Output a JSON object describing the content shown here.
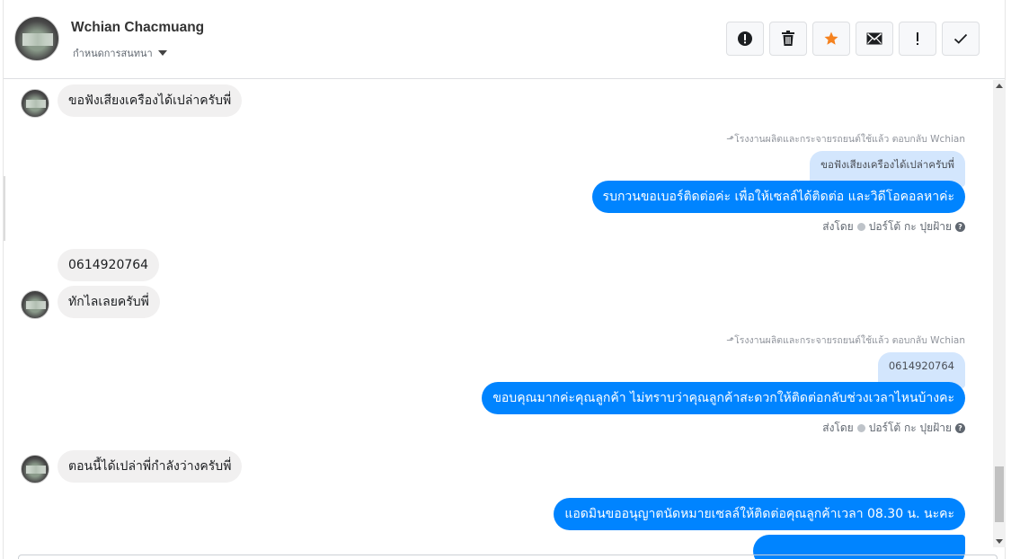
{
  "header": {
    "contact_name": "Wchian Chacmuang",
    "conversation_settings": "กำหนดการสนทนา",
    "actions": [
      {
        "name": "mark-spam",
        "icon": "exclamation-circle-icon"
      },
      {
        "name": "delete",
        "icon": "trash-icon"
      },
      {
        "name": "star",
        "icon": "star-icon",
        "color": "#f5821f"
      },
      {
        "name": "mark-unread",
        "icon": "envelope-icon"
      },
      {
        "name": "follow-up",
        "icon": "exclamation-icon"
      },
      {
        "name": "mark-done",
        "icon": "checkmark-icon"
      }
    ]
  },
  "messages": {
    "m1": "ขอฟังเสียงเครืองได้เปล่าครับพี่",
    "reply_note_1": "โรงงานผลิตและกระจายรถยนต์ใช้แล้ว ตอบกลับ Wchian",
    "quote_1": "ขอฟังเสียงเครืองได้เปล่าครับพี่",
    "m2": "รบกวนขอเบอร์ติดต่อค่ะ เพื่อให้เซลล์ได้ติดต่อ และวิดีโอคอลหาค่ะ",
    "sent_by_1": "ส่งโดย",
    "sender_1": "ปอร์โต้ กะ ปุยฝ้าย",
    "m3": "0614920764",
    "m4": "ทักไลเลยครับพี่",
    "reply_note_2": "โรงงานผลิตและกระจายรถยนต์ใช้แล้ว ตอบกลับ Wchian",
    "quote_2": "0614920764",
    "m5": "ขอบคุณมากค่ะคุณลูกค้า ไม่ทราบว่าคุณลูกค้าสะดวกให้ติดต่อกลับช่วงเวลาไหนบ้างคะ",
    "sent_by_2": "ส่งโดย",
    "sender_2": "ปอร์โต้ กะ ปุยฝ้าย",
    "m6": "ตอนนี้ได้เปล่าพี่กำลังว่างครับพี่",
    "m7": "แอดมินขออนุญาตนัดหมายเซลล์ให้ติดต่อคุณลูกค้าเวลา 08.30 น. นะคะ"
  },
  "colors": {
    "outgoing": "#0084ff",
    "incoming": "#f1f0f0",
    "quote": "#d3e6fd"
  }
}
